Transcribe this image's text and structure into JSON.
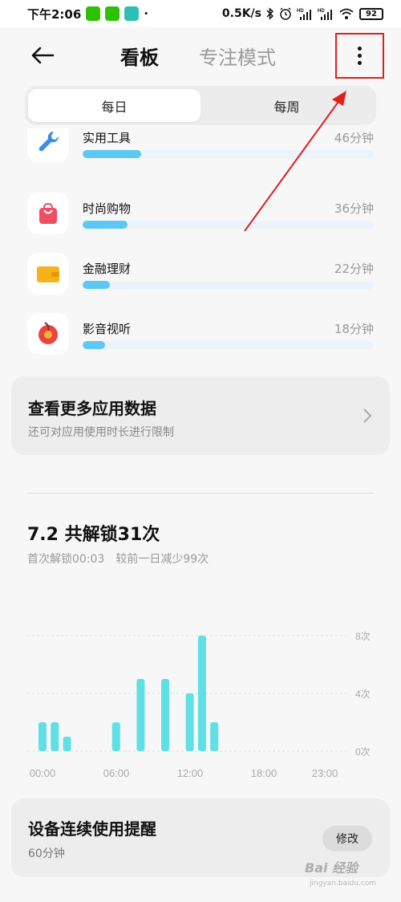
{
  "status_bar": {
    "time": "下午2:06",
    "speed": "0.5K/s",
    "battery": "92",
    "signal_label": "HD",
    "icons": [
      "wechat-icon",
      "wechat-icon",
      "message-icon",
      "bluetooth-icon",
      "alarm-icon",
      "signal-icon",
      "signal-icon",
      "wifi-icon",
      "battery-icon"
    ]
  },
  "header": {
    "tab_dashboard": "看板",
    "tab_focus": "专注模式",
    "back_icon": "back-arrow-icon",
    "more_icon": "more-vertical-icon"
  },
  "segment": {
    "daily": "每日",
    "weekly": "每周",
    "selected": "daily"
  },
  "apps": [
    {
      "name": "实用工具",
      "time": "46分钟",
      "usage_fraction": 0.2,
      "icon": "wrench-icon",
      "color": "#3a8fe3"
    },
    {
      "name": "时尚购物",
      "time": "36分钟",
      "usage_fraction": 0.155,
      "icon": "shopping-bag-icon",
      "color": "#ef4f64"
    },
    {
      "name": "金融理财",
      "time": "22分钟",
      "usage_fraction": 0.095,
      "icon": "wallet-icon",
      "color": "#f6b21b"
    },
    {
      "name": "影音视听",
      "time": "18分钟",
      "usage_fraction": 0.078,
      "icon": "music-icon",
      "color": "#e8453c"
    }
  ],
  "more_data": {
    "title": "查看更多应用数据",
    "subtitle": "还可对应用使用时长进行限制"
  },
  "unlock": {
    "title": "7.2 共解锁31次",
    "first_unlock": "首次解锁00:03",
    "compare": "较前一日减少99次"
  },
  "chart_data": {
    "type": "bar",
    "x_tick_labels": [
      "00:00",
      "06:00",
      "12:00",
      "18:00",
      "23:00"
    ],
    "y_tick_labels": [
      "8次",
      "4次",
      "0次"
    ],
    "ylim": [
      0,
      8
    ],
    "xlim": [
      0,
      23
    ],
    "grid": true,
    "color": "#5fe0e6",
    "x": [
      0,
      1,
      2,
      3,
      4,
      5,
      6,
      7,
      8,
      9,
      10,
      11,
      12,
      13,
      14,
      15,
      16,
      17,
      18,
      19,
      20,
      21,
      22,
      23
    ],
    "values": [
      2,
      2,
      1,
      0,
      0,
      0,
      2,
      0,
      5,
      0,
      5,
      0,
      4,
      8,
      2,
      0,
      0,
      0,
      0,
      0,
      0,
      0,
      0,
      0
    ]
  },
  "reminder": {
    "title": "设备连续使用提醒",
    "value": "60分钟",
    "button": "修改"
  },
  "watermark": {
    "main": "Bai 经验",
    "sub": "jingyan.baidu.com"
  }
}
